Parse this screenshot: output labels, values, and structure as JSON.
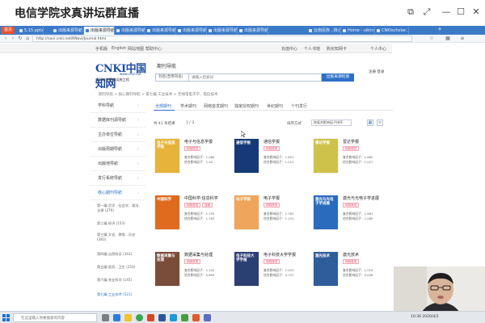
{
  "stream": {
    "title": "电信学院求真讲坛群直播"
  },
  "browser": {
    "first_tab": "首页",
    "tabs": [
      {
        "label": "5.15.pptx"
      },
      {
        "label": "出版来源导航"
      },
      {
        "label": "出版来源导航"
      },
      {
        "label": "出版来源导航"
      },
      {
        "label": "出版来源导航"
      },
      {
        "label": "出版来源导航"
      },
      {
        "label": "出版来源导航"
      },
      {
        "label": "出版来源导航"
      },
      {
        "label": "云南民族...核心期刊"
      },
      {
        "label": "Home - uibtra..."
      },
      {
        "label": "CNKIscholar..."
      }
    ],
    "url": "http://navi.cnki.net/KNavi/Journal.html"
  },
  "topnav": {
    "items": [
      "手机版",
      "English",
      "网站地图",
      "帮助中心"
    ],
    "right_items": [
      "充值中心",
      "个人书馆",
      "购买知网卡",
      "个人中心"
    ]
  },
  "header": {
    "logo_text": "CNKI中国知网",
    "logo_domain": "www.cnki.net",
    "logo_sub": "中国知识基础设施工程",
    "search_title": "期刊导航",
    "search_select": "刊名(曾用刊名)",
    "search_placeholder": "请输入检索词",
    "search_button": "出版来源检索",
    "user_link": "注册 登录"
  },
  "breadcrumb": "期刊导航 > 核心期刊导航 > 第七编 工业技术 > 无线电电子学、电信技术",
  "sidebar": {
    "items": [
      {
        "label": "学科导航"
      },
      {
        "label": "数据库刊源导航"
      },
      {
        "label": "主办单位导航"
      },
      {
        "label": "出版周期导航"
      },
      {
        "label": "出版地导航"
      },
      {
        "label": "发行系统导航"
      },
      {
        "label": "核心期刊导航"
      }
    ],
    "subs": [
      {
        "label": "第一编 哲学、社会学、政治、法律 (279)"
      },
      {
        "label": "第二编 经济 (153)"
      },
      {
        "label": "第三编 文化、教育、历史 (383)"
      },
      {
        "label": "第四编 自然科学 (343)"
      },
      {
        "label": "第五编 医药、卫生 (254)"
      },
      {
        "label": "第六编 农业科学 (145)"
      },
      {
        "label": "第七编 工业技术 (521)"
      }
    ]
  },
  "content_tabs": [
    "全部期刊",
    "学术期刊",
    "网络首发期刊",
    "独家授权期刊",
    "世纪期刊",
    "个刊发行"
  ],
  "info": {
    "count": "共 41 条结果",
    "pager": "1 / 3",
    "sort_label": "排序方式",
    "sort_value": "按复合影响因子排序"
  },
  "journals": [
    {
      "name": "电子与信息学报",
      "tags": [
        "网络首发"
      ],
      "impact1": "复合影响因子：1.080",
      "impact2": "综合影响因子：1.40",
      "color": "#e8b33a",
      "cover_text": "电子与信息学报"
    },
    {
      "name": "通信学报",
      "tags": [
        "网络首发"
      ],
      "impact1": "复合影响因子：1.851",
      "impact2": "综合影响因子：1.213",
      "color": "#163a77",
      "cover_text": "通信学报"
    },
    {
      "name": "雷达学报",
      "tags": [
        "网络首发"
      ],
      "impact1": "复合影响因子：1.680",
      "impact2": "综合影响因子：1.027",
      "color": "#cfc24a",
      "cover_text": "雷达学报"
    },
    {
      "name": "中国科学:信息科学",
      "tags": [
        "网络首发",
        "独家"
      ],
      "impact1": "复合影响因子：1.755",
      "impact2": "综合影响因子：1.183",
      "color": "#e06a1e",
      "cover_text": "中国科学"
    },
    {
      "name": "电子学报",
      "tags": [
        "网络首发"
      ],
      "impact1": "复合影响因子：1.763",
      "impact2": "综合影响因子：1.124",
      "color": "#f0a65a",
      "cover_text": "电子学报"
    },
    {
      "name": "激光与光电子学进展",
      "tags": [
        "网络首发"
      ],
      "impact1": "复合影响因子：1.681",
      "impact2": "综合影响因子：1.065",
      "color": "#2a6bbd",
      "cover_text": "激光与光电子学进展"
    },
    {
      "name": "数据采集与处理",
      "tags": [
        "网络首发"
      ],
      "impact1": "复合影响因子：1.102",
      "impact2": "综合影响因子：0.899",
      "color": "#7a4d3a",
      "cover_text": "数据采集与处理"
    },
    {
      "name": "电子科技大学学报",
      "tags": [
        "网络首发"
      ],
      "impact1": "复合影响因子：1.025",
      "impact2": "综合影响因子：0.737",
      "color": "#2c3f72",
      "cover_text": "电子科技大学学报"
    },
    {
      "name": "激光技术",
      "tags": [
        "网络首发"
      ],
      "impact1": "复合影响因子：1.019",
      "impact2": "综合影响因子：0.838",
      "color": "#2f5d9c",
      "cover_text": "激光技术"
    }
  ],
  "taskbar": {
    "search_placeholder": "在这里输入你要搜索的内容",
    "time": "10:36",
    "date": "2020/4/2"
  }
}
